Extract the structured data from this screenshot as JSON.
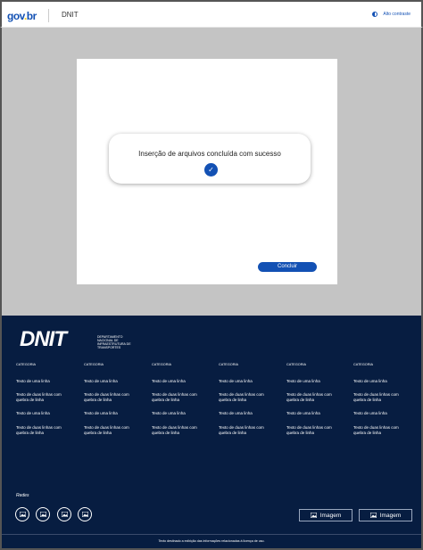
{
  "header": {
    "logo_g": "gov",
    "logo_dot": ".",
    "logo_b": "br",
    "app_name": "DNIT",
    "contrast_label": "Alto contraste"
  },
  "modal": {
    "message": "Inserção de arquivos concluída com sucesso",
    "check_glyph": "✓",
    "button_label": "Concluir"
  },
  "footer": {
    "logo": "DNIT",
    "logo_sub": "DEPARTAMENTO NACIONAL DE INFRAESTRUTURA DE TRANSPORTES",
    "columns": [
      {
        "category": "CATEGORIA",
        "links": [
          "Texto de uma linha",
          "Texto de duas linhas com quebra de linha",
          "Texto de uma linha",
          "Texto de duas linhas com quebra de linha"
        ]
      },
      {
        "category": "CATEGORIA",
        "links": [
          "Texto de uma linha",
          "Texto de duas linhas com quebra de linha",
          "Texto de uma linha",
          "Texto de duas linhas com quebra de linha"
        ]
      },
      {
        "category": "CATEGORIA",
        "links": [
          "Texto de uma linha",
          "Texto de duas linhas com quebra de linha",
          "Texto de uma linha",
          "Texto de duas linhas com quebra de linha"
        ]
      },
      {
        "category": "CATEGORIA",
        "links": [
          "Texto de uma linha",
          "Texto de duas linhas com quebra de linha",
          "Texto de uma linha",
          "Texto de duas linhas com quebra de linha"
        ]
      },
      {
        "category": "CATEGORIA",
        "links": [
          "Texto de uma linha",
          "Texto de duas linhas com quebra de linha",
          "Texto de uma linha",
          "Texto de duas linhas com quebra de linha"
        ]
      },
      {
        "category": "CATEGORIA",
        "links": [
          "Texto de uma linha",
          "Texto de duas linhas com quebra de linha",
          "Texto de uma linha",
          "Texto de duas linhas com quebra de linha"
        ]
      }
    ],
    "social_label": "Redes",
    "image_buttons": [
      "Imagem",
      "Imagem"
    ],
    "legal_text": "Texto destinado a exibição das informações relacionadas à licença de uso."
  },
  "colors": {
    "primary": "#1351b4",
    "footer_bg": "#071d41",
    "main_bg": "#c4c4c4"
  }
}
